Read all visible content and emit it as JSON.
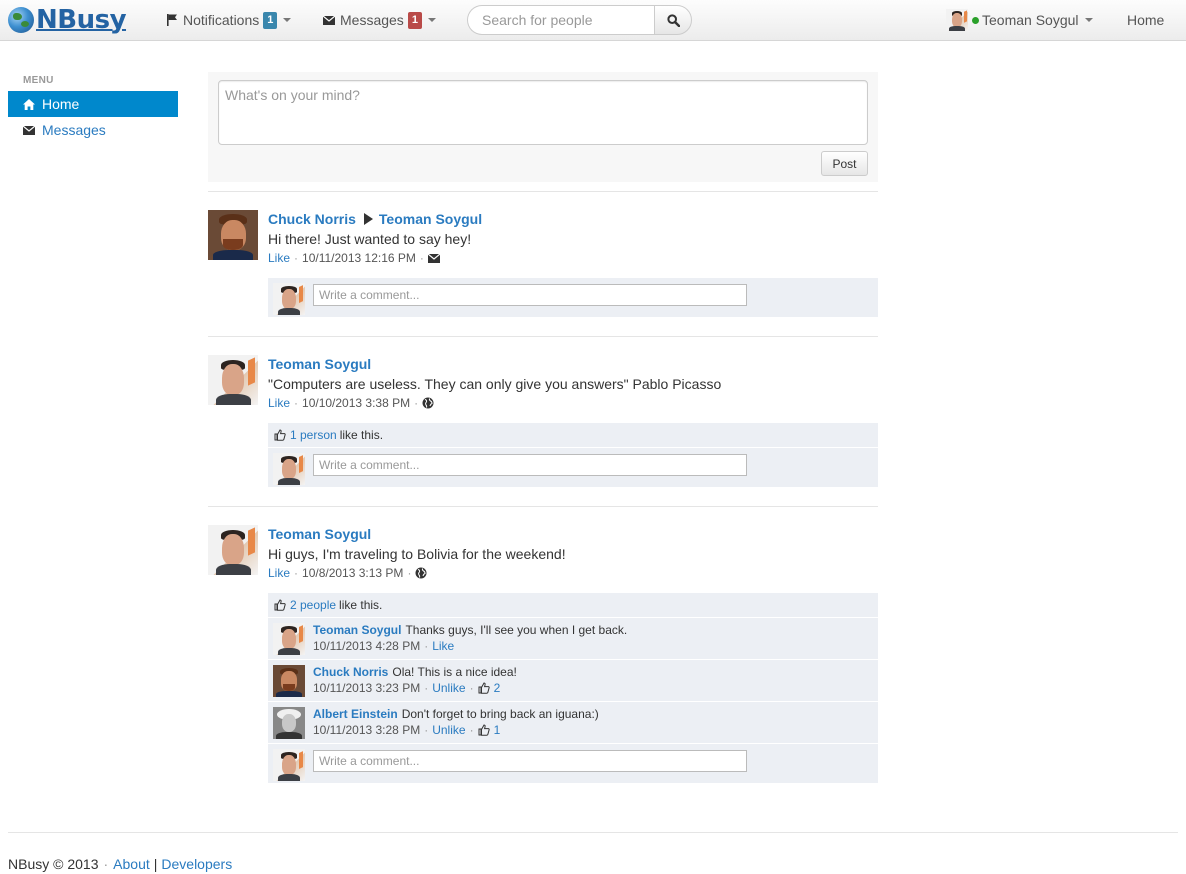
{
  "brand": {
    "name": "NBusy"
  },
  "navbar": {
    "notifications": {
      "label": "Notifications",
      "count": "1"
    },
    "messages": {
      "label": "Messages",
      "count": "1"
    },
    "search": {
      "placeholder": "Search for people"
    },
    "user": {
      "name": "Teoman Soygul",
      "status_color": "#2aa02a"
    },
    "home_label": "Home"
  },
  "sidebar": {
    "header": "MENU",
    "items": [
      {
        "label": "Home",
        "icon": "home-icon",
        "active": true
      },
      {
        "label": "Messages",
        "icon": "envelope-icon",
        "active": false
      }
    ]
  },
  "composer": {
    "placeholder": "What's on your mind?",
    "post_label": "Post"
  },
  "posts": [
    {
      "author": "Chuck Norris",
      "recipient": "Teoman Soygul",
      "text": "Hi there! Just wanted to say hey!",
      "like_label": "Like",
      "timestamp": "10/11/2013 12:16 PM",
      "privacy_icon": "envelope-icon",
      "comment_placeholder": "Write a comment..."
    },
    {
      "author": "Teoman Soygul",
      "text": "\"Computers are useless. They can only give you answers\" Pablo Picasso",
      "like_label": "Like",
      "timestamp": "10/10/2013 3:38 PM",
      "privacy_icon": "globe-icon",
      "likes": {
        "count_text": "1 person",
        "suffix": "like this."
      },
      "comment_placeholder": "Write a comment..."
    },
    {
      "author": "Teoman Soygul",
      "text": "Hi guys, I'm traveling to Bolivia for the weekend!",
      "like_label": "Like",
      "timestamp": "10/8/2013 3:13 PM",
      "privacy_icon": "globe-icon",
      "likes": {
        "count_text": "2 people",
        "suffix": "like this."
      },
      "comments": [
        {
          "author": "Teoman Soygul",
          "text": "Thanks guys, I'll see you when I get back.",
          "timestamp": "10/11/2013 4:28 PM",
          "action": "Like",
          "likes": ""
        },
        {
          "author": "Chuck Norris",
          "text": "Ola! This is a nice idea!",
          "timestamp": "10/11/2013 3:23 PM",
          "action": "Unlike",
          "likes": "2"
        },
        {
          "author": "Albert Einstein",
          "text": "Don't forget to bring back an iguana:)",
          "timestamp": "10/11/2013 3:28 PM",
          "action": "Unlike",
          "likes": "1"
        }
      ],
      "comment_placeholder": "Write a comment..."
    }
  ],
  "footer": {
    "copyright": "NBusy © 2013",
    "separator": "·",
    "about": "About",
    "pipe": "|",
    "developers": "Developers"
  }
}
